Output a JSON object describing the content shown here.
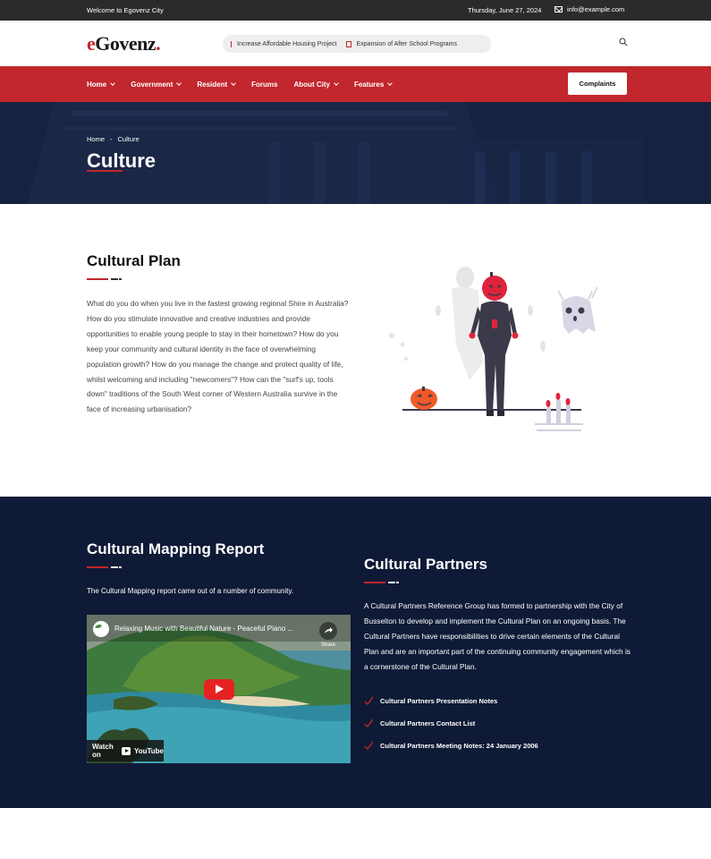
{
  "topbar": {
    "welcome": "Welcome to Egovenz City",
    "date": "Thursday, June 27, 2024",
    "email": "info@example.com"
  },
  "header": {
    "logo_first": "e",
    "logo_rest": "Govenz",
    "logo_dot": ".",
    "ticker": [
      "Increase Affordable Housing Project",
      "Expansion of After School Programs"
    ]
  },
  "nav": {
    "items": [
      {
        "label": "Home",
        "dropdown": true
      },
      {
        "label": "Government",
        "dropdown": true
      },
      {
        "label": "Resident",
        "dropdown": true
      },
      {
        "label": "Forums",
        "dropdown": false
      },
      {
        "label": "About City",
        "dropdown": true
      },
      {
        "label": "Features",
        "dropdown": true
      }
    ],
    "cta": "Complaints"
  },
  "hero": {
    "breadcrumb_home": "Home",
    "breadcrumb_sep": "-",
    "breadcrumb_current": "Culture",
    "title": "Culture"
  },
  "plan": {
    "title": "Cultural Plan",
    "text": "What do you do when you live in the fastest growing regional Shire in Australia? How do you stimulate innovative and creative industries and provide opportunities to enable young people to stay in their hometown? How do you keep your community and cultural identity in the face of overwhelming population growth? How do you manage the change and protect quality of life, whilst welcoming and including \"newcomers\"? How can the \"surf's up, tools down\" traditions of the South West corner of Western Australia survive in the face of increasing urbanisation?"
  },
  "mapping": {
    "title": "Cultural Mapping Report",
    "text": "The Cultural Mapping report came out of a number of community.",
    "video_title": "Relaxing Music with Beautiful Nature - Peaceful Piano ...",
    "share": "Share",
    "watch_on": "Watch on",
    "youtube": "YouTube"
  },
  "partners": {
    "title": "Cultural Partners",
    "text": "A Cultural Partners Reference Group has formed to partnership with the City of Busselton to develop and implement the Cultural Plan on an ongoing basis. The Cultural Partners have responsibilities to drive certain elements of the Cultural Plan and are an important part of the continuing community engagement which is a cornerstone of the Cultural Plan.",
    "links": [
      "Cultural Partners Presentation Notes",
      "Cultural Partners Contact List",
      "Cultural Partners Meeting Notes: 24 January 2006"
    ]
  },
  "colors": {
    "accent": "#c1272d",
    "dark_navy": "#0f1a36",
    "topbar": "#2b2b2b"
  }
}
